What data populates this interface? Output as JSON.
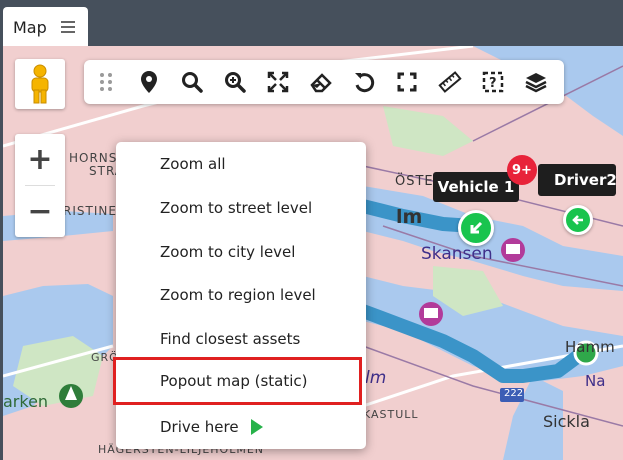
{
  "tab": {
    "label": "Map",
    "menu_icon": "hamburger-menu-icon"
  },
  "toolbar": {
    "buttons": [
      {
        "icon": "drag-handle-icon"
      },
      {
        "icon": "map-pin-icon"
      },
      {
        "icon": "search-icon"
      },
      {
        "icon": "zoom-in-icon"
      },
      {
        "icon": "zoom-all-icon"
      },
      {
        "icon": "eraser-icon"
      },
      {
        "icon": "undo-icon"
      },
      {
        "icon": "fullscreen-icon"
      },
      {
        "icon": "ruler-icon"
      },
      {
        "icon": "help-area-icon"
      },
      {
        "icon": "layers-icon"
      }
    ]
  },
  "zoom": {
    "plus": "+",
    "minus": "−"
  },
  "context_menu": {
    "items": [
      {
        "label": "Zoom all"
      },
      {
        "label": "Zoom to street level"
      },
      {
        "label": "Zoom to city level"
      },
      {
        "label": "Zoom to region level"
      },
      {
        "label": "Find closest assets"
      },
      {
        "label": "Popout map (static)",
        "highlighted": true
      },
      {
        "label": "Drive here"
      }
    ]
  },
  "vehicles": {
    "vehicle1": {
      "label": "Vehicle 1",
      "badge": "9+"
    },
    "driver2": {
      "label": "Driver2"
    }
  },
  "map_labels": {
    "hornsberg_1": "HORNS",
    "hornsberg_2": "STRA",
    "kristine": "RISTINE",
    "ostermalm": "ÖSTE",
    "skansen": "Skansen",
    "gro": "GRÖ",
    "parken": "arken",
    "hagersten": "HÄGERSTEN-LILJEHOLMEN",
    "kastull": "KASTULL",
    "sickla": "Sickla",
    "hammarby": "Hamm",
    "nacka": "Na",
    "road_222": "222",
    "lm": "lm",
    "holm": "lm"
  },
  "colors": {
    "topbar": "#46505c",
    "map_bg": "#f1cfcf",
    "water": "#aac9ee",
    "route": "#3b94c8",
    "highlight_border": "#e02020",
    "vehicle_green": "#19c44e",
    "badge_red": "#e8233a"
  }
}
